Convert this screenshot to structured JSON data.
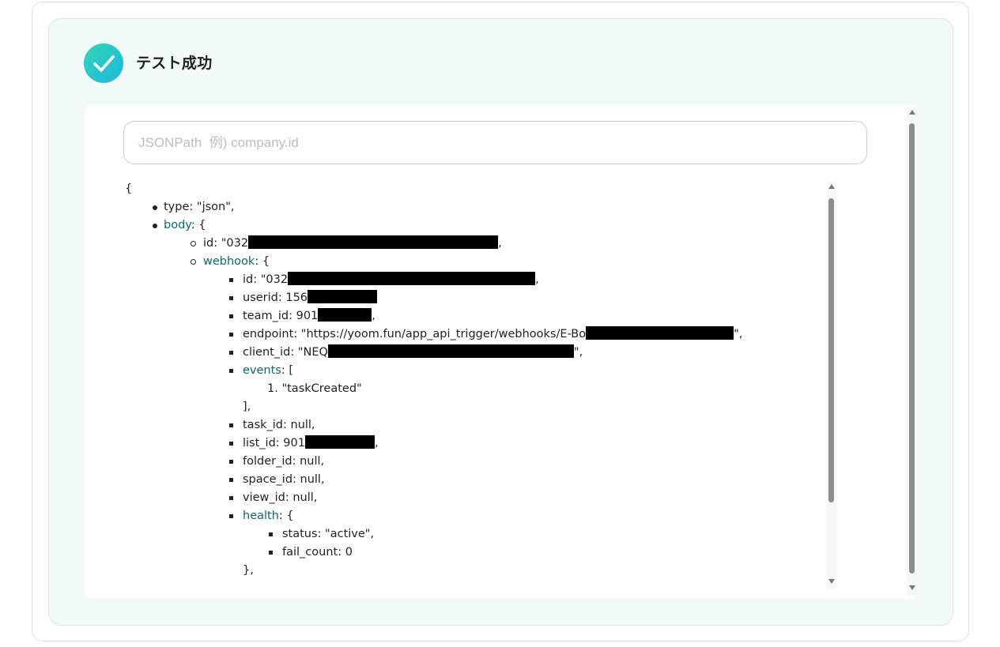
{
  "status": {
    "title": "テスト成功",
    "icon": "check-icon",
    "accent_start": "#2fd6b4",
    "accent_end": "#1eb7e0"
  },
  "search": {
    "placeholder": "JSONPath  例) company.id",
    "value": ""
  },
  "json_view": {
    "open_root": "{",
    "type_key": "type",
    "type_value": "\"json\",",
    "body_key": "body",
    "open_brace": ": {",
    "body_id_key": "id",
    "body_id_value": "\"032",
    "body_id_suffix": ",",
    "webhook_key": "webhook",
    "webhook_id_key": "id",
    "webhook_id_value": "\"032",
    "webhook_id_suffix": ",",
    "userid_key": "userid",
    "userid_value": "156",
    "team_id_key": "team_id",
    "team_id_value": "901",
    "team_id_suffix": ",",
    "endpoint_key": "endpoint",
    "endpoint_value": "\"https://yoom.fun/app_api_trigger/webhooks/E-Bo",
    "endpoint_suffix": "\",",
    "client_id_key": "client_id",
    "client_id_value": "\"NEQ",
    "client_id_suffix": "\",",
    "events_key": "events",
    "events_open": ": [",
    "events_item_index": "1.",
    "events_item_value": "\"taskCreated\"",
    "events_close": "],",
    "task_id": "task_id: null,",
    "list_id_key": "list_id",
    "list_id_value": "901",
    "list_id_suffix": ",",
    "folder_id": "folder_id: null,",
    "space_id": "space_id: null,",
    "view_id": "view_id: null,",
    "health_key": "health",
    "health_open": ": {",
    "status_line": "status: \"active\",",
    "fail_count_line": "fail_count: 0",
    "health_close": "},"
  }
}
